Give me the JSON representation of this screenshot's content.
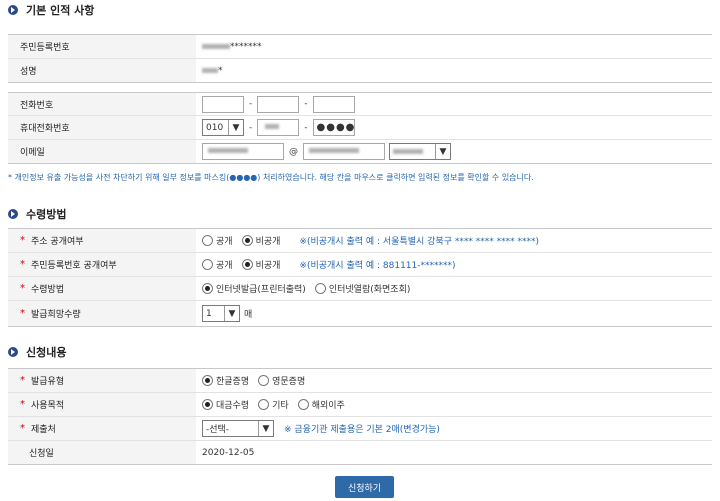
{
  "section1": {
    "title": "기본 인적 사항",
    "rrn_label": "주민등록번호",
    "rrn_value": "*******",
    "name_label": "성명",
    "name_value": "*",
    "phone_label": "전화번호",
    "mobile_label": "휴대전화번호",
    "mobile_prefix": "010",
    "mobile_last": "●●●●",
    "email_label": "이메일",
    "email_at": "@",
    "notice": "* 개인정보 유출 가능성을 사전 차단하기 위해 일부 정보를 마스킹(●●●●) 처리하였습니다. 해당 칸을 마우스로 클릭하면 입력된 정보를 확인할 수 있습니다."
  },
  "section2": {
    "title": "수령방법",
    "addr_label": "주소 공개여부",
    "addr_opt1": "공개",
    "addr_opt2": "비공개",
    "addr_note": "※(비공개시 출력 예 : 서울특별시 강북구 **** **** **** ****)",
    "rrn_pub_label": "주민등록번호 공개여부",
    "rrn_opt1": "공개",
    "rrn_opt2": "비공개",
    "rrn_note": "※(비공개시 출력 예 : 881111-*******)",
    "method_label": "수령방법",
    "method_opt1": "인터넷발급(프린터출력)",
    "method_opt2": "인터넷열람(화면조회)",
    "count_label": "발급희망수량",
    "count_value": "1",
    "count_unit": "매"
  },
  "section3": {
    "title": "신청내용",
    "type_label": "발급유형",
    "type_opt1": "한글증명",
    "type_opt2": "영문증명",
    "purpose_label": "사용목적",
    "purpose_opt1": "대금수령",
    "purpose_opt2": "기타",
    "purpose_opt3": "해외이주",
    "submit_to_label": "제출처",
    "submit_to_value": "-선택-",
    "submit_to_note": "※ 금융기관 제출용은 기본 2매(변경가능)",
    "date_label": "신청일",
    "date_value": "2020-12-05"
  },
  "submit_button": "신청하기",
  "colors": {
    "accent": "#2e6aa8",
    "required": "#cc0000",
    "note": "#2466b3"
  }
}
